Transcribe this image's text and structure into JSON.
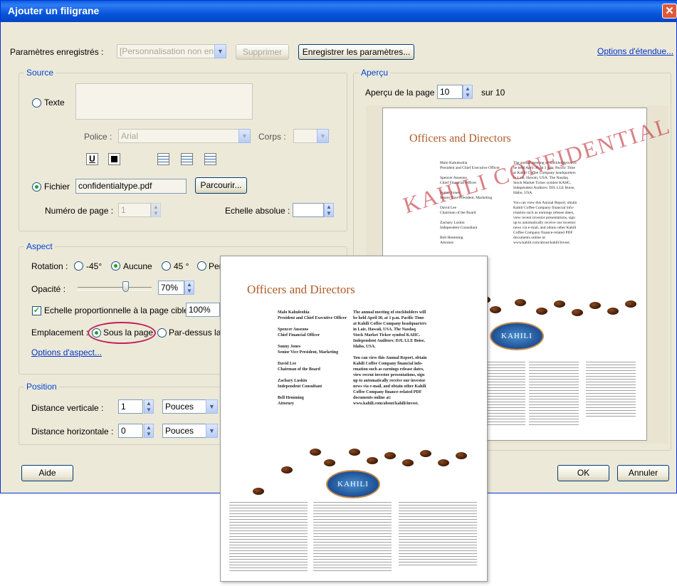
{
  "window": {
    "title": "Ajouter un filigrane"
  },
  "top": {
    "saved_label": "Paramètres enregistrés :",
    "saved_value": "[Personnalisation non enr",
    "delete_button": "Supprimer",
    "save_button": "Enregistrer les paramètres...",
    "advanced_link": "Options d'étendue..."
  },
  "source": {
    "group_title": "Source",
    "text_option": "Texte",
    "font_label": "Police :",
    "font_value": "Arial",
    "size_label": "Corps :",
    "file_option": "Fichier",
    "file_value": "confidentialtype.pdf",
    "browse_button": "Parcourir...",
    "page_number_label": "Numéro de page :",
    "page_number_value": "1",
    "abs_scale_label": "Echelle absolue :",
    "underline_glyph": "U"
  },
  "aspect": {
    "group_title": "Aspect",
    "rotation_label": "Rotation :",
    "rot_minus45": "-45°",
    "rot_none": "Aucune",
    "rot_45": "45 °",
    "rot_custom": "Pers",
    "opacity_label": "Opacité :",
    "opacity_value": "70%",
    "scale_check": "Echelle proportionnelle à la page cible",
    "scale_value": "100%",
    "placement_label": "Emplacement :",
    "placement_under": "Sous la page",
    "placement_over": "Par-dessus la p",
    "options_link": "Options d'aspect..."
  },
  "position": {
    "group_title": "Position",
    "vertical_label": "Distance verticale :",
    "vertical_value": "1",
    "vertical_unit": "Pouces",
    "horizontal_label": "Distance horizontale :",
    "horizontal_value": "0",
    "horizontal_unit": "Pouces"
  },
  "preview": {
    "group_title": "Aperçu",
    "page_label": "Aperçu de la page",
    "page_value": "10",
    "page_of": "sur 10"
  },
  "buttons": {
    "help": "Aide",
    "ok": "OK",
    "cancel": "Annuler"
  },
  "document": {
    "title": "Officers and Directors",
    "watermark": "KAHILI CONFIDENTIAL",
    "logo": "KAHILI",
    "names": "Malo Kahuleohia\nPresident and Chief Executive Officer\n\nSpencer Anseons\nChief Financial Officer\n\nSunny Jones\nSenior Vice President, Marketing\n\nDavid Lee\nChairman of the Board\n\nZachary Luskin\nIndependent Consultant\n\nBell Hemming\nAttorney",
    "meeting": "The annual meeting of stockholders will\nbe held April 30, at 1 p.m. Pacific Time\nat Kahili Coffee Company headquarters\nin Laie, Hawaii, USA. The Nasdaq\nStock Market Ticker symbol KAHC.\nIndependent Auditors: DJL LLE Boise,\nIdaho, USA.\n\nYou can view this Annual Report, obtain\nKahili Coffee Company financial info-\nrmation such as earnings release dates,\nview recent investor presentations, sign\nup to automatically receive our investor\nnews via e-mail, and obtain other Kahili\nCoffee Company finance-related PDF\ndocuments online at:\nwww.kahili.com/about/kahili/invest."
  },
  "colors": {
    "accent_ring": "#c0205a",
    "title_orange": "#b05a26",
    "watermark_red": "#c0303a"
  }
}
